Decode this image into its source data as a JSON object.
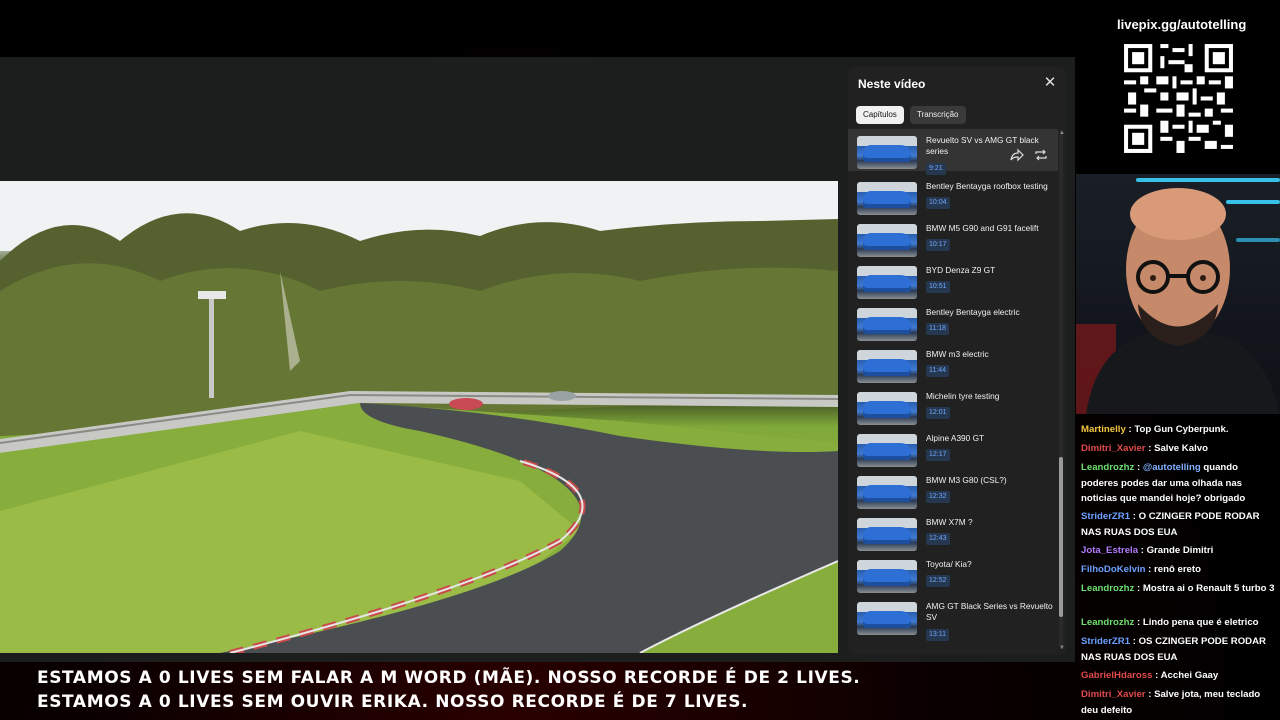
{
  "overlay": {
    "livepix_url": "livepix.gg/autotelling"
  },
  "chapters_panel": {
    "title": "Neste vídeo",
    "close_glyph": "✕",
    "tabs": [
      {
        "label": "Capítulos",
        "selected": true
      },
      {
        "label": "Transcrição",
        "selected": false
      }
    ],
    "chapters": [
      {
        "title": "Revuelto SV vs AMG GT black series",
        "time": "9:21",
        "active": true
      },
      {
        "title": "Bentley Bentayga roofbox testing",
        "time": "10:04"
      },
      {
        "title": "BMW M5 G90 and G91 facelift",
        "time": "10:17"
      },
      {
        "title": "BYD Denza Z9 GT",
        "time": "10:51"
      },
      {
        "title": "Bentley Bentayga electric",
        "time": "11:18"
      },
      {
        "title": "BMW m3 electric",
        "time": "11:44"
      },
      {
        "title": "Michelin tyre testing",
        "time": "12:01"
      },
      {
        "title": "Alpine A390 GT",
        "time": "12:17"
      },
      {
        "title": "BMW M3 G80 (CSL?)",
        "time": "12:32"
      },
      {
        "title": "BMW X7M ?",
        "time": "12:43"
      },
      {
        "title": "Toyota/ Kia?",
        "time": "12:52"
      },
      {
        "title": "AMG GT Black Series vs Revuelto SV",
        "time": "13:11"
      }
    ]
  },
  "chat": {
    "messages": [
      {
        "user": "Martinelly",
        "color": "#f5c542",
        "text": "Top Gun Cyberpunk."
      },
      {
        "user": "Dimitri_Xavier",
        "color": "#e04a4a",
        "text": "Salve Kalvo"
      },
      {
        "user": "Leandrozhz",
        "color": "#6ee06e",
        "mention": "@autotelling",
        "text": "quando poderes podes dar uma olhada nas noticias que mandei hoje? obrigado"
      },
      {
        "user": "StriderZR1",
        "color": "#6aa0ff",
        "text": "O CZINGER PODE RODAR NAS RUAS DOS EUA"
      },
      {
        "user": "Jota_Estrela",
        "color": "#b07cff",
        "text": "Grande Dimitri"
      },
      {
        "user": "FilhoDoKelvin",
        "color": "#6aa0ff",
        "text": "renô ereto"
      },
      {
        "user": "Leandrozhz",
        "color": "#6ee06e",
        "text": "Mostra ai o Renault 5 turbo 3"
      },
      {
        "user": "Leandrozhz",
        "color": "#6ee06e",
        "text": "Lindo pena que é eletrico"
      },
      {
        "user": "StriderZR1",
        "color": "#6aa0ff",
        "text": "OS CZINGER PODE RODAR NAS RUAS DOS EUA"
      },
      {
        "user": "GabrielHdaross",
        "color": "#e04a4a",
        "text": "Acchei Gaay"
      },
      {
        "user": "Dimitri_Xavier",
        "color": "#e04a4a",
        "text": "Salve jota, meu teclado deu defeito"
      }
    ]
  },
  "ticker": {
    "line1": "ESTAMOS A 0 LIVES SEM FALAR A M WORD (MÃE). NOSSO RECORDE É DE 2 LIVES.",
    "line2": "ESTAMOS A 0 LIVES SEM OUVIR ERIKA. NOSSO RECORDE É DE 7 LIVES."
  }
}
